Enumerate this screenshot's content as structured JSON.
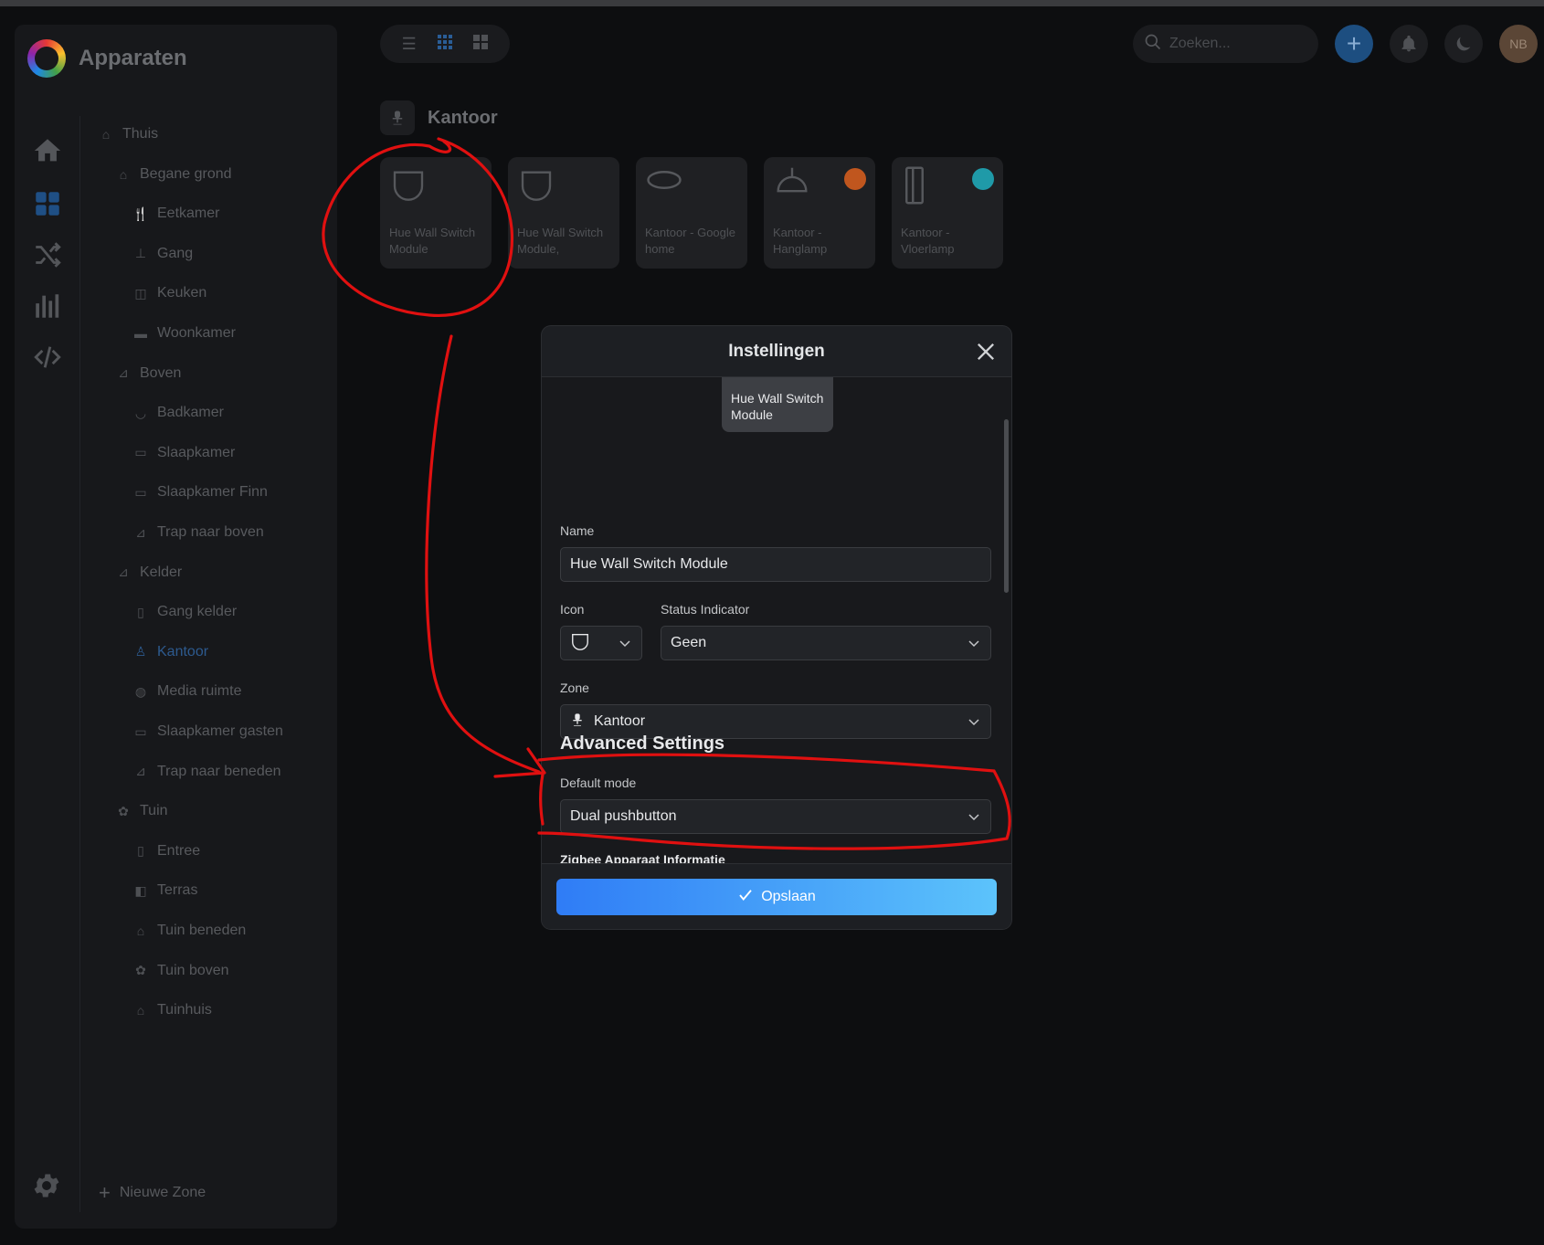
{
  "app": {
    "title": "Apparaten"
  },
  "topbar": {
    "search_placeholder": "Zoeken...",
    "avatar_initials": "NB"
  },
  "sidebar": {
    "zones": [
      {
        "label": "Thuis",
        "icon": "home-icon",
        "level": 0
      },
      {
        "label": "Begane grond",
        "icon": "floor-icon",
        "level": 1
      },
      {
        "label": "Eetkamer",
        "icon": "cutlery-icon",
        "level": 2
      },
      {
        "label": "Gang",
        "icon": "lamp-icon",
        "level": 2
      },
      {
        "label": "Keuken",
        "icon": "pot-icon",
        "level": 2
      },
      {
        "label": "Woonkamer",
        "icon": "sofa-icon",
        "level": 2
      },
      {
        "label": "Boven",
        "icon": "stairs-icon",
        "level": 1
      },
      {
        "label": "Badkamer",
        "icon": "bathtub-icon",
        "level": 2
      },
      {
        "label": "Slaapkamer",
        "icon": "bed-icon",
        "level": 2
      },
      {
        "label": "Slaapkamer Finn",
        "icon": "bed-icon",
        "level": 2
      },
      {
        "label": "Trap naar boven",
        "icon": "stairs-icon",
        "level": 2
      },
      {
        "label": "Kelder",
        "icon": "stairs-icon",
        "level": 1
      },
      {
        "label": "Gang kelder",
        "icon": "door-icon",
        "level": 2
      },
      {
        "label": "Kantoor",
        "icon": "office-chair-icon",
        "level": 2,
        "active": true
      },
      {
        "label": "Media ruimte",
        "icon": "gamepad-icon",
        "level": 2
      },
      {
        "label": "Slaapkamer gasten",
        "icon": "bed-icon",
        "level": 2
      },
      {
        "label": "Trap naar beneden",
        "icon": "stairs-icon",
        "level": 2
      },
      {
        "label": "Tuin",
        "icon": "flower-icon",
        "level": 1
      },
      {
        "label": "Entree",
        "icon": "door-icon",
        "level": 2
      },
      {
        "label": "Terras",
        "icon": "door-open-icon",
        "level": 2
      },
      {
        "label": "Tuin beneden",
        "icon": "gazebo-icon",
        "level": 2
      },
      {
        "label": "Tuin boven",
        "icon": "flower-icon",
        "level": 2
      },
      {
        "label": "Tuinhuis",
        "icon": "shed-icon",
        "level": 2
      }
    ],
    "new_zone": "Nieuwe Zone"
  },
  "room": {
    "title": "Kantoor",
    "devices": [
      {
        "label": "Hue Wall Switch Module",
        "icon": "switch-module-icon",
        "dot": ""
      },
      {
        "label": "Hue Wall Switch Module,",
        "icon": "switch-module-icon",
        "dot": ""
      },
      {
        "label": "Kantoor - Google home",
        "icon": "speaker-icon",
        "dot": ""
      },
      {
        "label": "Kantoor - Hanglamp",
        "icon": "pendant-lamp-icon",
        "dot": "#c0561e"
      },
      {
        "label": "Kantoor - Vloerlamp",
        "icon": "floor-lamp-icon",
        "dot": "#1f9aa8"
      }
    ]
  },
  "modal": {
    "title": "Instellingen",
    "preview_label": "Hue Wall Switch Module",
    "name_label": "Name",
    "name_value": "Hue Wall Switch Module",
    "icon_label": "Icon",
    "status_label": "Status Indicator",
    "status_value": "Geen",
    "zone_label": "Zone",
    "zone_value": "Kantoor",
    "advanced_title": "Advanced Settings",
    "default_mode_label": "Default mode",
    "default_mode_value": "Dual pushbutton",
    "zigbee_title": "Zigbee Apparaat Informatie",
    "save_label": "Opslaan"
  },
  "colors": {
    "accent": "#2f7cf6",
    "annotation": "#e01010",
    "active_zone": "#2d5a8f"
  }
}
